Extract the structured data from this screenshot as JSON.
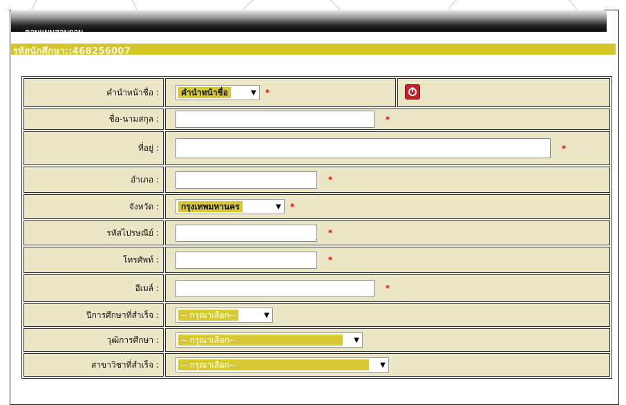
{
  "header": {
    "title": "ตอบแบบสอบถาม"
  },
  "student": {
    "id_text": "รหัสนักศึกษา::468256007"
  },
  "form": {
    "prefix": {
      "label": "คำนำหน้าชื่อ :",
      "selected": "คำนำหน้าชื่อ",
      "required": "*"
    },
    "fullname": {
      "label": "ชื่อ-นามสกุล :",
      "value": "",
      "required": "*"
    },
    "address": {
      "label": "ที่อยู่ :",
      "value": "",
      "required": "*"
    },
    "district": {
      "label": "อำเภอ :",
      "value": "",
      "required": "*"
    },
    "province": {
      "label": "จังหวัด :",
      "selected": "กรุงเทพมหานคร",
      "required": "*"
    },
    "postal": {
      "label": "รหัสไปรษณีย์ :",
      "value": "",
      "required": "*"
    },
    "phone": {
      "label": "โทรศัพท์ :",
      "value": "",
      "required": "*"
    },
    "email": {
      "label": "อีเมล์ :",
      "value": "",
      "required": "*"
    },
    "grad_year": {
      "label": "ปีการศึกษาที่สำเร็จ :",
      "selected": "-- กรุณาเลือก--"
    },
    "degree": {
      "label": "วุฒิการศึกษา :",
      "selected": "-- กรุณาเลือก--"
    },
    "major": {
      "label": "สาขาวิชาที่สำเร็จ :",
      "selected": "-- กรุณาเลือก--"
    }
  },
  "icons": {
    "power": "power-icon",
    "dropdown": "chevron-down-icon"
  },
  "colors": {
    "row_bg": "#ebe7c6",
    "highlight": "#d6c934",
    "id_bar": "#d3c52a",
    "required": "#ee0000",
    "power": "#c8202a"
  }
}
